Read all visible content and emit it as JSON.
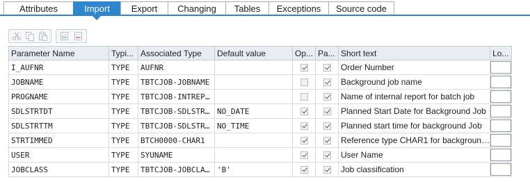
{
  "tabs": [
    {
      "label": "Attributes",
      "active": false
    },
    {
      "label": "Import",
      "active": true
    },
    {
      "label": "Export",
      "active": false
    },
    {
      "label": "Changing",
      "active": false
    },
    {
      "label": "Tables",
      "active": false
    },
    {
      "label": "Exceptions",
      "active": false
    },
    {
      "label": "Source code",
      "active": false
    }
  ],
  "toolbar": {
    "icons": [
      "cut-icon",
      "copy-icon",
      "paste-icon",
      "insert-row-icon",
      "delete-row-icon"
    ]
  },
  "colors": {
    "accent": "#2e86cf",
    "header_bg": "#e7edf3"
  },
  "grid": {
    "columns": [
      "Parameter Name",
      "Typi...",
      "Associated Type",
      "Default value",
      "Op...",
      "Pa...",
      "Short text",
      "Lo..."
    ],
    "rows": [
      {
        "name": "I_AUFNR",
        "typing": "TYPE",
        "assoc": "AUFNR",
        "default": "",
        "optional": true,
        "pass_value": true,
        "short_text": "Order Number"
      },
      {
        "name": "JOBNAME",
        "typing": "TYPE",
        "assoc": "TBTCJOB-JOBNAME",
        "default": "",
        "optional": false,
        "pass_value": true,
        "short_text": "Background job name"
      },
      {
        "name": "PROGNAME",
        "typing": "TYPE",
        "assoc": "TBTCJOB-INTREP…",
        "default": "",
        "optional": false,
        "pass_value": true,
        "short_text": "Name of internal report for batch job"
      },
      {
        "name": "SDLSTRTDT",
        "typing": "TYPE",
        "assoc": "TBTCJOB-SDLSTR…",
        "default": "NO_DATE",
        "optional": true,
        "pass_value": true,
        "short_text": "Planned Start Date for Background Job"
      },
      {
        "name": "SDLSTRTTM",
        "typing": "TYPE",
        "assoc": "TBTCJOB-SDLSTR…",
        "default": "NO_TIME",
        "optional": true,
        "pass_value": true,
        "short_text": "Planned start time for background Job"
      },
      {
        "name": "STRTIMMED",
        "typing": "TYPE",
        "assoc": "BTCH0000-CHAR1",
        "default": "",
        "optional": true,
        "pass_value": true,
        "short_text": "Reference type CHAR1 for backgroun…"
      },
      {
        "name": "USER",
        "typing": "TYPE",
        "assoc": "SYUNAME",
        "default": "",
        "optional": true,
        "pass_value": true,
        "short_text": "User Name"
      },
      {
        "name": "JOBCLASS",
        "typing": "TYPE",
        "assoc": "TBTCJOB-JOBCLA…",
        "default": "'B'",
        "optional": true,
        "pass_value": true,
        "short_text": "Job classification"
      }
    ]
  }
}
